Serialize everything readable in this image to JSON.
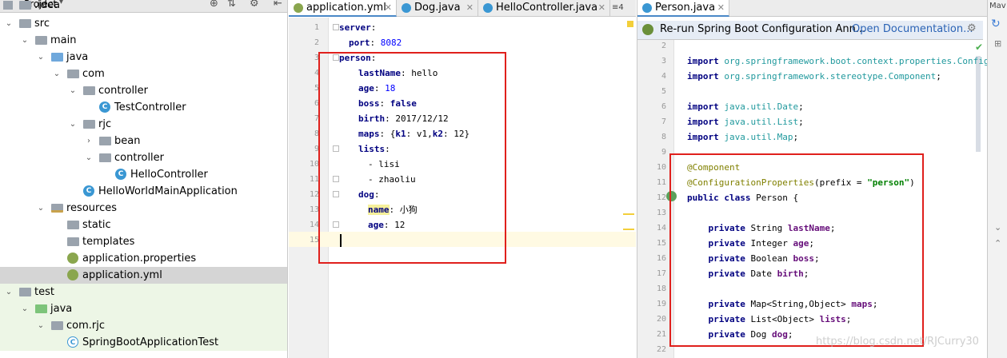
{
  "project": {
    "title": "Project",
    "tree": [
      {
        "label": ".idea",
        "icon": "folder-icon"
      },
      {
        "label": "src",
        "icon": "folder-icon"
      },
      {
        "label": "main",
        "icon": "folder-icon"
      },
      {
        "label": "java",
        "icon": "source-folder-icon"
      },
      {
        "label": "com",
        "icon": "package-icon"
      },
      {
        "label": "controller",
        "icon": "package-icon"
      },
      {
        "label": "TestController",
        "icon": "class-icon"
      },
      {
        "label": "rjc",
        "icon": "package-icon"
      },
      {
        "label": "bean",
        "icon": "package-icon"
      },
      {
        "label": "controller",
        "icon": "package-icon"
      },
      {
        "label": "HelloController",
        "icon": "class-icon"
      },
      {
        "label": "HelloWorldMainApplication",
        "icon": "class-icon"
      },
      {
        "label": "resources",
        "icon": "resources-folder-icon"
      },
      {
        "label": "static",
        "icon": "folder-icon"
      },
      {
        "label": "templates",
        "icon": "folder-icon"
      },
      {
        "label": "application.properties",
        "icon": "spring-config-icon"
      },
      {
        "label": "application.yml",
        "icon": "spring-config-icon"
      },
      {
        "label": "test",
        "icon": "folder-icon"
      },
      {
        "label": "java",
        "icon": "test-source-folder-icon"
      },
      {
        "label": "com.rjc",
        "icon": "package-icon"
      },
      {
        "label": "SpringBootApplicationTest",
        "icon": "test-class-icon"
      }
    ]
  },
  "left_editor": {
    "tabs": [
      "application.yml",
      "Dog.java",
      "HelloController.java"
    ],
    "tab_overflow": "≡4",
    "line_numbers": [
      "1",
      "2",
      "3",
      "4",
      "5",
      "6",
      "7",
      "8",
      "9",
      "10",
      "11",
      "12",
      "13",
      "14",
      "15"
    ],
    "lines": [
      [
        "server",
        ":"
      ],
      [
        "port",
        ": ",
        "8082"
      ],
      [
        "person",
        ":"
      ],
      [
        "lastName",
        ": hello"
      ],
      [
        "age",
        ": ",
        "18"
      ],
      [
        "boss",
        ": ",
        "false"
      ],
      [
        "birth",
        ": 2017/12/12"
      ],
      [
        "maps",
        ": {",
        "k1",
        ": v1,",
        "k2",
        ": 12}"
      ],
      [
        "lists",
        ":"
      ],
      [
        "- lisi"
      ],
      [
        "- zhaoliu"
      ],
      [
        "dog",
        ":"
      ],
      [
        "name",
        ": 小狗"
      ],
      [
        "age",
        ": 12"
      ],
      [
        ""
      ]
    ]
  },
  "right_editor": {
    "tab": "Person.java",
    "banner_text": "Re-run Spring Boot Configuration Ann...",
    "banner_link": "Open Documentation...",
    "line_numbers": [
      "2",
      "3",
      "4",
      "5",
      "6",
      "7",
      "8",
      "9",
      "10",
      "11",
      "12",
      "13",
      "14",
      "15",
      "16",
      "17",
      "18",
      "19",
      "20",
      "21",
      "22"
    ],
    "lines": [
      "",
      "import org.springframework.boot.context.properties.Configurati",
      "import org.springframework.stereotype.Component;",
      "",
      "import java.util.Date;",
      "import java.util.List;",
      "import java.util.Map;",
      "",
      "@Component",
      "@ConfigurationProperties(prefix = \"person\")",
      "public class Person {",
      "",
      "    private String lastName;",
      "    private Integer age;",
      "    private Boolean boss;",
      "    private Date birth;",
      "",
      "    private Map<String,Object> maps;",
      "    private List<Object> lists;",
      "    private Dog dog;",
      ""
    ]
  },
  "right_panel": {
    "label": "Mav"
  },
  "watermark": "https://blog.csdn.net/RJCurry30"
}
